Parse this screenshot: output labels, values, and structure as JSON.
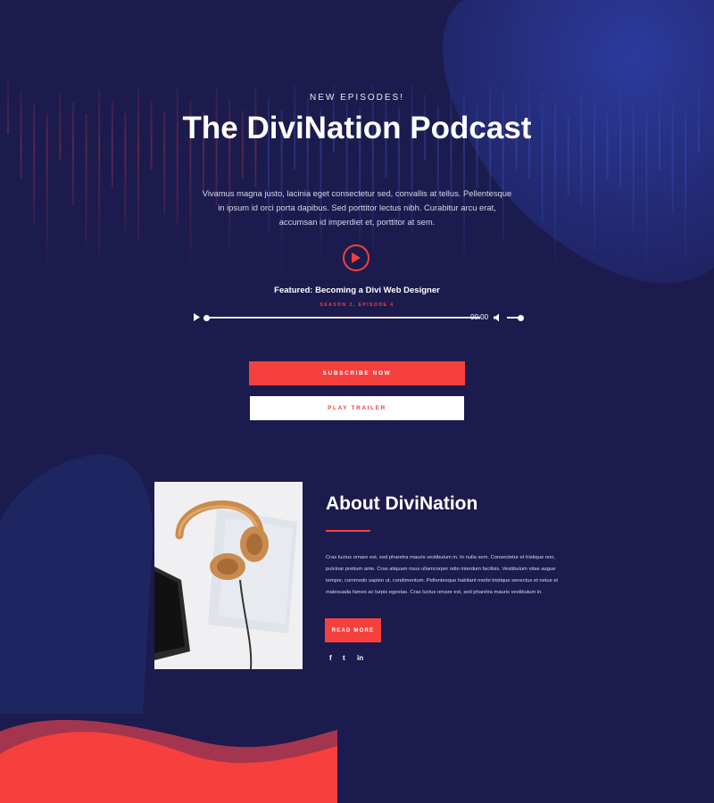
{
  "hero": {
    "eyebrow": "NEW EPISODES!",
    "title": "The DiviNation Podcast",
    "description": "Vivamus magna justo, lacinia eget consectetur sed, convallis at tellus. Pellentesque in ipsum id orci porta dapibus. Sed porttitor lectus nibh. Curabitur arcu erat, accumsan id imperdiet et, porttitor at sem."
  },
  "episode": {
    "featured_title": "Featured: Becoming a Divi Web Designer",
    "season_label": "SEASON 2, EPISODE 4",
    "player_time": "00:00"
  },
  "buttons": {
    "subscribe": "SUBSCRIBE NOW",
    "trailer": "PLAY TRAILER",
    "read_more": "READ MORE"
  },
  "about": {
    "title": "About DiviNation",
    "body": "Cras luctus ornare est, sed pharetra mauris vestibulum in. In nulla sem. Consectetur et tristique non, pulvinar pretium ante. Cras aliquam risus ullamcorper odio interdum facilisis. Vestibulum vitae augue tempor, commodo sapien ut, condimentum. Pellentesque habitant morbi tristique senectus et netus et malesuada fames ac turpis egestas. Cras luctus ornare est, sed pharetra mauris vestibulum in."
  },
  "social": {
    "facebook": "f",
    "twitter": "t",
    "linkedin": "in"
  },
  "icons": {
    "hero_play": "play-circle-icon",
    "player_play": "play-icon",
    "volume": "volume-icon",
    "facebook": "facebook-icon",
    "twitter": "twitter-icon",
    "linkedin": "linkedin-icon"
  },
  "colors": {
    "background": "#1c1b4d",
    "accent": "#f5403e",
    "text": "#ffffff"
  }
}
